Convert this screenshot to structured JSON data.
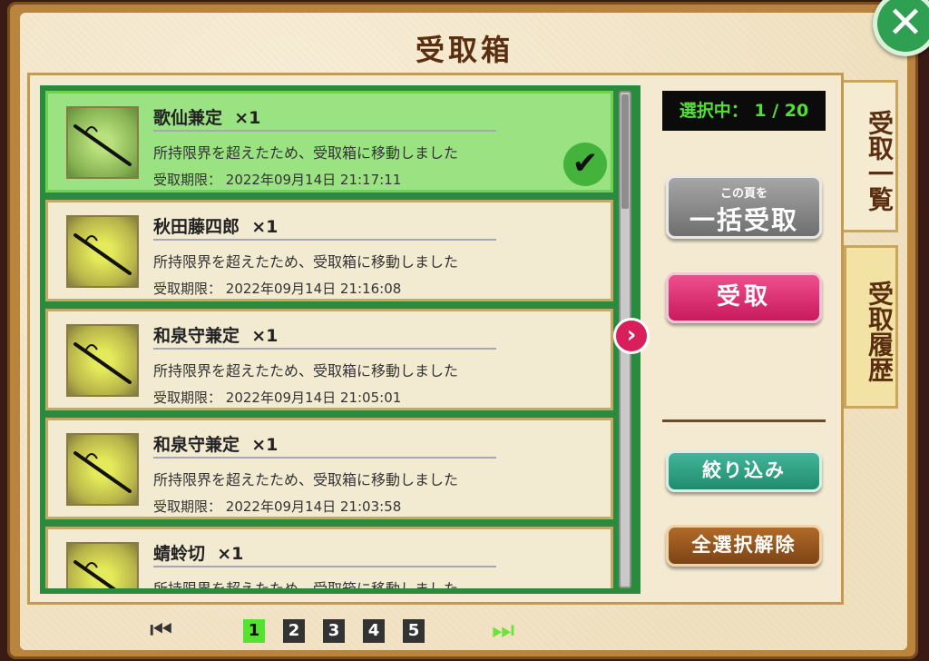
{
  "window": {
    "title": "受取箱"
  },
  "selection": {
    "label": "選択中：",
    "current": "1",
    "total": "20",
    "text": "選択中： 1 / 20"
  },
  "items": [
    {
      "name": "歌仙兼定",
      "qty": "×1",
      "desc": "所持限界を超えたため、受取箱に移動しました",
      "expire_label": "受取期限：",
      "expire": "2022年09月14日 21:17:11",
      "selected": true
    },
    {
      "name": "秋田藤四郎",
      "qty": "×1",
      "desc": "所持限界を超えたため、受取箱に移動しました",
      "expire_label": "受取期限：",
      "expire": "2022年09月14日 21:16:08",
      "selected": false
    },
    {
      "name": "和泉守兼定",
      "qty": "×1",
      "desc": "所持限界を超えたため、受取箱に移動しました",
      "expire_label": "受取期限：",
      "expire": "2022年09月14日 21:05:01",
      "selected": false
    },
    {
      "name": "和泉守兼定",
      "qty": "×1",
      "desc": "所持限界を超えたため、受取箱に移動しました",
      "expire_label": "受取期限：",
      "expire": "2022年09月14日 21:03:58",
      "selected": false
    },
    {
      "name": "蜻蛉切",
      "qty": "×1",
      "desc": "所持限界を超えたため、受取箱に移動しました",
      "expire_label": "",
      "expire": "",
      "selected": false
    }
  ],
  "buttons": {
    "bulk_sub": "この頁を",
    "bulk_main": "一括受取",
    "receive": "受取",
    "filter": "絞り込み",
    "deselect_all": "全選択解除"
  },
  "tabs": {
    "list": "受取一覧",
    "history": "受取履歴"
  },
  "pagination": {
    "pages": [
      "1",
      "2",
      "3",
      "4",
      "5"
    ],
    "current": "1",
    "first_icon": "⏮",
    "last_icon": "⏭"
  },
  "icons": {
    "close": "close-icon",
    "check": "check-icon",
    "next": "chevron-right-icon",
    "sword": "sword-icon"
  },
  "colors": {
    "accent_green": "#2a8a3e",
    "receive_pink": "#d81f5c",
    "selection_text": "#52e032"
  }
}
